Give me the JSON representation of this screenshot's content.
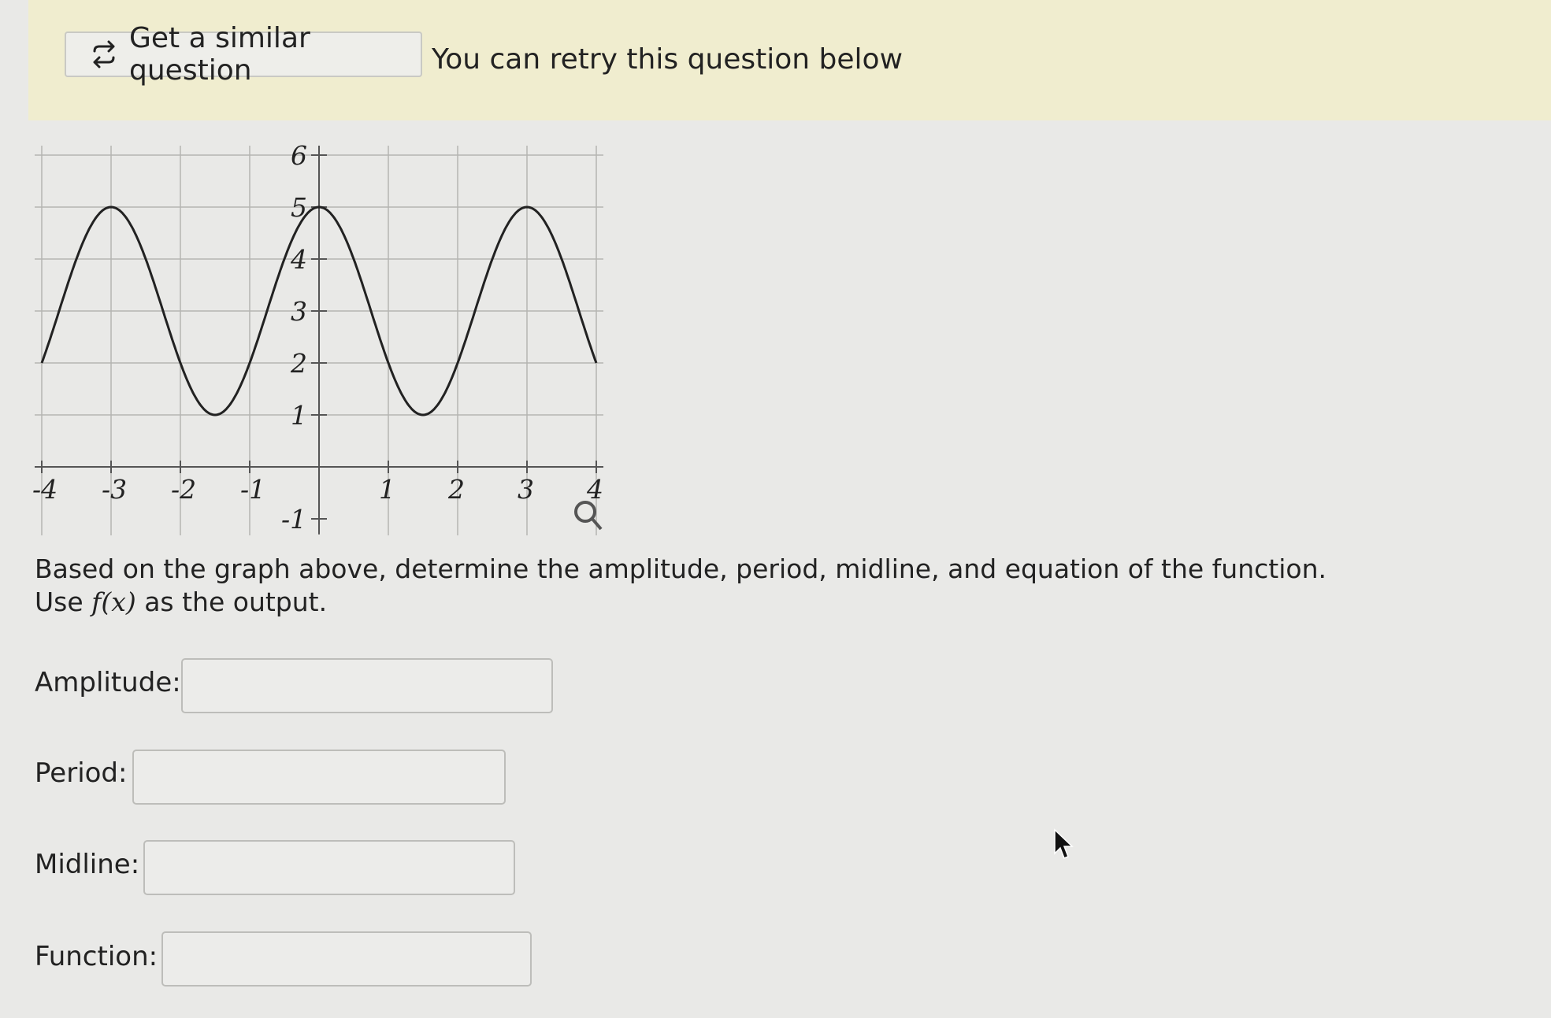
{
  "banner": {
    "similar_button_label": "Get a similar question",
    "retry_note": "You can retry this question below",
    "icon": "retry-arrows-icon",
    "background": "#f0edcf"
  },
  "chart_data": {
    "type": "line",
    "x_ticks": [
      "-4",
      "-3",
      "-2",
      "-1",
      "1",
      "2",
      "3",
      "4"
    ],
    "y_ticks": [
      "-1",
      "1",
      "2",
      "3",
      "4",
      "5",
      "6"
    ],
    "xlim": [
      -4.2,
      4
    ],
    "ylim": [
      -1,
      6
    ],
    "grid": true,
    "function_curve": {
      "description_values": {
        "max": 5,
        "min": 1,
        "midline": 3,
        "period": 3,
        "peak_x": [
          -3,
          0,
          3
        ],
        "trough_x": [
          -1.5,
          1.5
        ]
      },
      "x_range": [
        -4,
        4
      ]
    },
    "zoom_icon": "magnifier-icon"
  },
  "question": {
    "text_before": "Based on the graph above, determine the amplitude, period, midline, and equation of the function. Use ",
    "math": "f(x)",
    "text_after": " as the output."
  },
  "fields": {
    "amplitude_label": "Amplitude:",
    "period_label": "Period:",
    "midline_label": "Midline:",
    "function_label": "Function:",
    "amplitude_value": "",
    "period_value": "",
    "midline_value": "",
    "function_value": ""
  }
}
